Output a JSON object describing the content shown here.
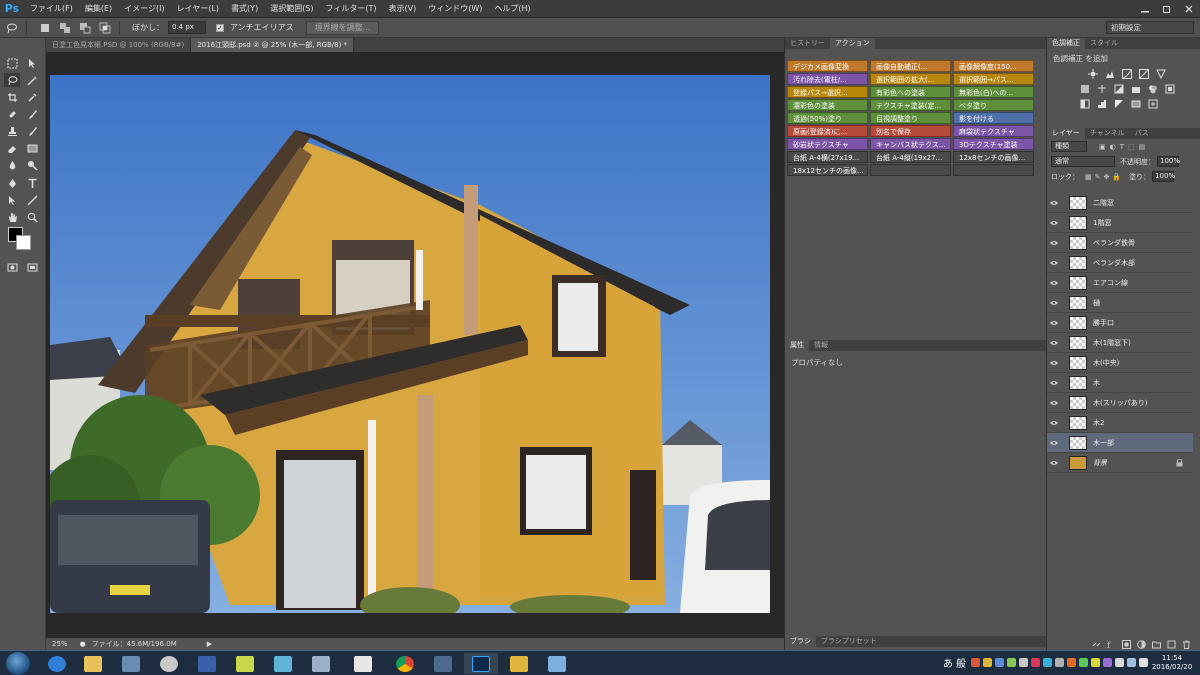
{
  "app": {
    "logo": "Ps"
  },
  "menu": [
    "ファイル(F)",
    "編集(E)",
    "イメージ(I)",
    "レイヤー(L)",
    "書式(Y)",
    "選択範囲(S)",
    "フィルター(T)",
    "表示(V)",
    "ウィンドウ(W)",
    "ヘルプ(H)"
  ],
  "options": {
    "feather_label": "ぼかし：",
    "feather_value": "0.4 px",
    "antialias_label": "アンチエイリアス",
    "refine_edge": "境界線を調整...",
    "workspace": "初期設定"
  },
  "doc_tabs": [
    "日塗工色見本帳.PSD @ 100% (RGB/8#)",
    "2016江頭邸.psd ② @ 25% (木一部, RGB/8) *"
  ],
  "status": {
    "zoom": "25%",
    "file_info": "ファイル：45.6M/196.0M"
  },
  "history_panel": {
    "tabs": [
      "ヒストリー",
      "アクション"
    ]
  },
  "actions": [
    {
      "label": "デジカメ画像変換",
      "color": "#c0792a"
    },
    {
      "label": "画像自動補正(...",
      "color": "#c0792a"
    },
    {
      "label": "画像解像度(150...",
      "color": "#c0792a"
    },
    {
      "label": "汚れ除去(電柱/...",
      "color": "#7d55a8"
    },
    {
      "label": "選択範囲の拡大(...",
      "color": "#b8860b"
    },
    {
      "label": "選択範囲→パス...",
      "color": "#b8860b"
    },
    {
      "label": "登録パス→選択...",
      "color": "#b8860b"
    },
    {
      "label": "有彩色への塗装",
      "color": "#5e8f3a"
    },
    {
      "label": "無彩色(白)への...",
      "color": "#5e8f3a"
    },
    {
      "label": "濃彩色の塗装",
      "color": "#5e8f3a"
    },
    {
      "label": "テクスチャ塗装(定...",
      "color": "#5e8f3a"
    },
    {
      "label": "ベタ塗り",
      "color": "#5e8f3a"
    },
    {
      "label": "透過(50%)塗り",
      "color": "#5e8f3a"
    },
    {
      "label": "目視調整塗り",
      "color": "#5e8f3a"
    },
    {
      "label": "影を付ける",
      "color": "#4f6fa8"
    },
    {
      "label": "原画(登録済)に...",
      "color": "#b84a3a"
    },
    {
      "label": "別名で保存",
      "color": "#b84a3a"
    },
    {
      "label": "麻袋状テクスチャ",
      "color": "#7d55a8"
    },
    {
      "label": "砂岩状テクスチャ",
      "color": "#7d55a8"
    },
    {
      "label": "キャンバス状テクス...",
      "color": "#7d55a8"
    },
    {
      "label": "3Dテクスチャ塗装",
      "color": "#7d55a8"
    },
    {
      "label": "台紙 A-4横(27x19...",
      "color": "#4a4a4a"
    },
    {
      "label": "台紙 A-4縦(19x27...",
      "color": "#4a4a4a"
    },
    {
      "label": "12x8センチの画像...",
      "color": "#4a4a4a"
    },
    {
      "label": "18x12センチの画像...",
      "color": "#4a4a4a"
    },
    {
      "label": "",
      "color": "#4a4a4a"
    },
    {
      "label": "",
      "color": "#4a4a4a"
    }
  ],
  "properties_panel": {
    "tabs": [
      "属性",
      "情報"
    ],
    "empty_text": "プロパティなし"
  },
  "brush_panel": {
    "tabs": [
      "ブラシ",
      "ブラシプリセット"
    ]
  },
  "adjustments_panel": {
    "tabs": [
      "色調補正",
      "スタイル"
    ],
    "title": "色調補正 を追加"
  },
  "layers_panel": {
    "tabs": [
      "レイヤー",
      "チャンネル",
      "パス"
    ],
    "filter_kind": "種類",
    "blend_mode": "通常",
    "opacity_label": "不透明度：",
    "opacity_value": "100%",
    "lock_label": "ロック：",
    "fill_label": "塗り：",
    "fill_value": "100%",
    "layers": [
      {
        "name": "二階窓",
        "selected": false
      },
      {
        "name": "1階窓",
        "selected": false
      },
      {
        "name": "ベランダ鉄骨",
        "selected": false
      },
      {
        "name": "ベランダ木部",
        "selected": false
      },
      {
        "name": "エアコン線",
        "selected": false
      },
      {
        "name": "樋",
        "selected": false
      },
      {
        "name": "勝手口",
        "selected": false
      },
      {
        "name": "木(1階窓下)",
        "selected": false
      },
      {
        "name": "木(中央)",
        "selected": false
      },
      {
        "name": "木",
        "selected": false
      },
      {
        "name": "木(スリッパあり)",
        "selected": false
      },
      {
        "name": "木2",
        "selected": false
      },
      {
        "name": "木一部",
        "selected": true
      },
      {
        "name": "背景",
        "selected": false,
        "locked": true
      }
    ]
  },
  "taskbar": {
    "ime": "あ 般",
    "time": "11:54",
    "date": "2016/02/20"
  }
}
